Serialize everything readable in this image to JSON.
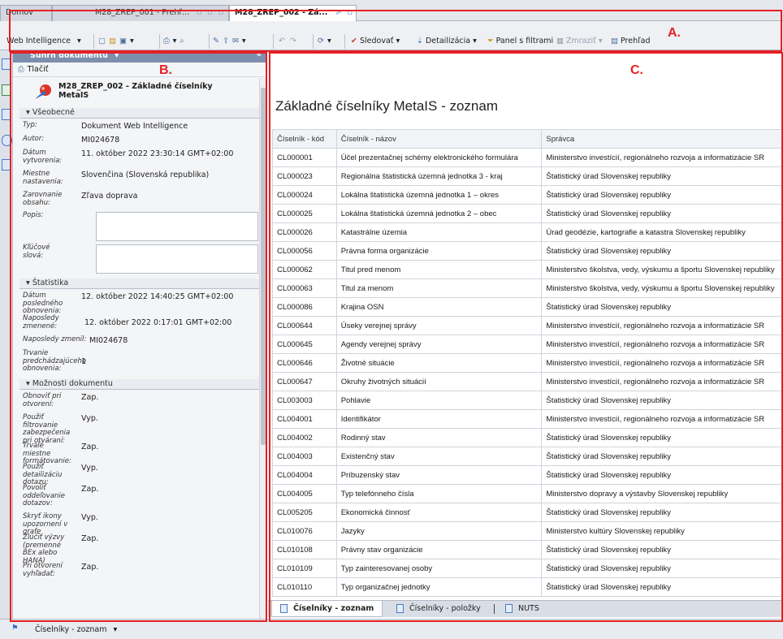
{
  "tabs": [
    {
      "label": "Domov",
      "active": false
    },
    {
      "label": "M28_ZREP_001 - Prehľ...",
      "active": false
    },
    {
      "label": "M28_ZREP_002 - Zá...",
      "active": true
    }
  ],
  "toolbar": {
    "app_menu": "Web Intelligence",
    "track_label": "Sledovať",
    "drill_label": "Detailizácia",
    "filter_panel_label": "Panel s filtrami",
    "freeze_label": "Zmraziť",
    "outline_label": "Prehľad"
  },
  "annotations": {
    "a": "A.",
    "b": "B.",
    "c": "C."
  },
  "panel": {
    "title": "Súhrn dokumentu",
    "print_label": "Tlačiť",
    "doc_title_line1": "M28_ZREP_002 - Základné číselníky",
    "doc_title_line2": "MetaIS",
    "sections": {
      "general": "Všeobecné",
      "stats": "Štatistika",
      "options": "Možnosti dokumentu"
    },
    "general": [
      {
        "k": "Typ:",
        "v": "Dokument Web Intelligence"
      },
      {
        "k": "Autor:",
        "v": "MI024678"
      },
      {
        "k": "Dátum vytvorenia:",
        "v": "11. október 2022 23:30:14 GMT+02:00"
      },
      {
        "k": "Miestne nastavenia:",
        "v": "Slovenčina (Slovenská republika)"
      },
      {
        "k": "Zarovnanie obsahu:",
        "v": "Zľava doprava"
      }
    ],
    "description_label": "Popis:",
    "keywords_label": "Kľúčové slová:",
    "stats": [
      {
        "k": "Dátum posledného obnovenia:",
        "v": "12. október 2022 14:40:25 GMT+02:00"
      },
      {
        "k": "Naposledy zmenené:",
        "v": "12. október 2022 0:17:01 GMT+02:00"
      },
      {
        "k": "Naposledy zmenil:",
        "v": "MI024678"
      },
      {
        "k": "Trvanie predchádzajúceho obnovenia:",
        "v": "1"
      }
    ],
    "options": [
      {
        "k": "Obnoviť pri otvorení:",
        "v": "Zap."
      },
      {
        "k": "Použiť filtrovanie zabezpečenia pri otváraní:",
        "v": "Vyp."
      },
      {
        "k": "Trvalé miestne formátovanie:",
        "v": "Zap."
      },
      {
        "k": "Použiť detailizáciu dotazu:",
        "v": "Vyp."
      },
      {
        "k": "Povoliť oddeľovanie dotazov:",
        "v": "Zap."
      },
      {
        "k": "Skryť ikony upozornení v grafe",
        "v": "Vyp."
      },
      {
        "k": "Zlúčiť výzvy (premenné BEx alebo HANA)",
        "v": "Zap."
      },
      {
        "k": "Pri otvorení vyhľadať:",
        "v": "Zap."
      }
    ]
  },
  "report": {
    "title": "Základné číselníky MetaIS - zoznam",
    "columns": [
      "Číselník - kód",
      "Číselník - názov",
      "Správca"
    ],
    "rows": [
      [
        "CL000001",
        "Účel prezentačnej schémy elektronického formulára",
        "Ministerstvo investícií, regionálneho rozvoja a informatizácie SR"
      ],
      [
        "CL000023",
        "Regionálna štatistická územná jednotka 3 - kraj",
        "Štatistický úrad Slovenskej republiky"
      ],
      [
        "CL000024",
        "Lokálna štatistická územná jednotka 1 – okres",
        "Štatistický úrad Slovenskej republiky"
      ],
      [
        "CL000025",
        "Lokálna štatistická územná jednotka 2 – obec",
        "Štatistický úrad Slovenskej republiky"
      ],
      [
        "CL000026",
        "Katastrálne územia",
        "Úrad geodézie, kartografie a katastra Slovenskej republiky"
      ],
      [
        "CL000056",
        "Právna forma organizácie",
        "Štatistický úrad Slovenskej republiky"
      ],
      [
        "CL000062",
        "Titul pred menom",
        "Ministerstvo školstva, vedy, výskumu a športu Slovenskej republiky"
      ],
      [
        "CL000063",
        "Titul za menom",
        "Ministerstvo školstva, vedy, výskumu a športu Slovenskej republiky"
      ],
      [
        "CL000086",
        "Krajina OSN",
        "Štatistický úrad Slovenskej republiky"
      ],
      [
        "CL000644",
        "Úseky verejnej správy",
        "Ministerstvo investícií, regionálneho rozvoja a informatizácie SR"
      ],
      [
        "CL000645",
        "Agendy verejnej správy",
        "Ministerstvo investícií, regionálneho rozvoja a informatizácie SR"
      ],
      [
        "CL000646",
        "Životné situácie",
        "Ministerstvo investícií, regionálneho rozvoja a informatizácie SR"
      ],
      [
        "CL000647",
        "Okruhy životných situácií",
        "Ministerstvo investícií, regionálneho rozvoja a informatizácie SR"
      ],
      [
        "CL003003",
        "Pohlavie",
        "Štatistický úrad Slovenskej republiky"
      ],
      [
        "CL004001",
        "Identifikátor",
        "Ministerstvo investícií, regionálneho rozvoja a informatizácie SR"
      ],
      [
        "CL004002",
        "Rodinný stav",
        "Štatistický úrad Slovenskej republiky"
      ],
      [
        "CL004003",
        "Existenčný stav",
        "Štatistický úrad Slovenskej republiky"
      ],
      [
        "CL004004",
        "Príbuzenský stav",
        "Štatistický úrad Slovenskej republiky"
      ],
      [
        "CL004005",
        "Typ telefónneho čísla",
        "Ministerstvo dopravy a výstavby Slovenskej republiky"
      ],
      [
        "CL005205",
        "Ekonomická činnosť",
        "Štatistický úrad Slovenskej republiky"
      ],
      [
        "CL010076",
        "Jazyky",
        "Ministerstvo kultúry Slovenskej republiky"
      ],
      [
        "CL010108",
        "Právny stav organizácie",
        "Štatistický úrad Slovenskej republiky"
      ],
      [
        "CL010109",
        "Typ zainteresovanej osoby",
        "Štatistický úrad Slovenskej republiky"
      ],
      [
        "CL010110",
        "Typ organizačnej jednotky",
        "Štatistický úrad Slovenskej republiky"
      ]
    ]
  },
  "report_tabs": [
    {
      "label": "Číselníky - zoznam",
      "active": true
    },
    {
      "label": "Číselníky - položky",
      "active": false
    },
    {
      "label": "NUTS",
      "active": false
    }
  ],
  "status": {
    "report_name": "Číselníky - zoznam"
  },
  "colors": {
    "annotation": "#e52024",
    "panel_header": "#7d8fad",
    "accent_blue": "#2f6fc9"
  }
}
